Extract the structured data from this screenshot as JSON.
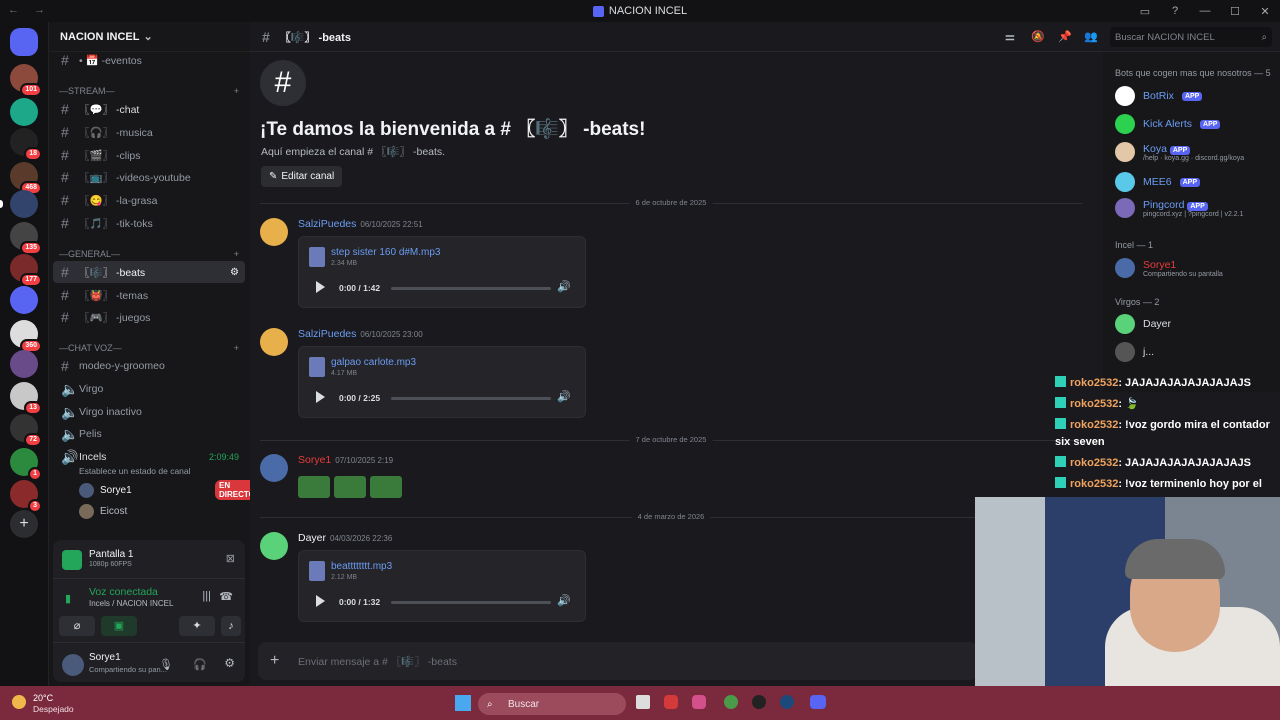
{
  "window": {
    "title": "NACION INCEL",
    "nav": "← →",
    "controls": [
      "▭",
      "?",
      "—",
      "☐",
      "✕"
    ]
  },
  "server": {
    "name": "NACION INCEL"
  },
  "channels": [
    {
      "name": "• 📅 -eventos"
    },
    {
      "category": "—STREAM—"
    },
    {
      "name": "〖💬〗 -chat"
    },
    {
      "name": "〖🎧〗 -musica"
    },
    {
      "name": "〖🎬〗 -clips"
    },
    {
      "name": "〖📺〗 -videos-youtube"
    },
    {
      "name": "〖😋〗 -la-grasa"
    },
    {
      "name": "〖🎵〗 -tik-toks"
    },
    {
      "category": "—GENERAL—"
    },
    {
      "name": "〖🎼〗 -beats"
    },
    {
      "name": "〖👹〗 -temas"
    },
    {
      "name": "〖🎮〗 -juegos"
    },
    {
      "category": "—CHAT VOZ—"
    },
    {
      "name": "modeo-y-groomeo"
    },
    {
      "name": "Virgo"
    },
    {
      "name": "Virgo inactivo"
    },
    {
      "name": "Pelis"
    },
    {
      "name": "Incels",
      "timer": "2:09:49",
      "status": "Establece un estado de canal"
    }
  ],
  "voice_users": [
    {
      "name": "Sorye1",
      "badge": "EN DIRECTO"
    },
    {
      "name": "Eicost"
    }
  ],
  "server_badges": [
    "101",
    "18",
    "468",
    "135",
    "177",
    "360",
    "13",
    "72",
    "1",
    "3"
  ],
  "stream_panel": {
    "title": "Pantalla 1",
    "quality": "1080p 60FPS"
  },
  "voice_panel": {
    "status": "Voz conectada",
    "location": "Incels / NACION INCEL"
  },
  "user_panel": {
    "name": "Sorye1",
    "status": "Compartiendo su pan..."
  },
  "channel_header": {
    "name": "〖🎼〗 -beats"
  },
  "search_placeholder": "Buscar NACION INCEL",
  "welcome": {
    "title": "¡Te damos la bienvenida a # 〖🎼〗 -beats!",
    "subtitle": "Aquí empieza el canal # 〖🎼〗 -beats.",
    "edit_button": "Editar canal"
  },
  "dates": [
    "6 de octubre de 2025",
    "7 de octubre de 2025",
    "4 de marzo de 2026"
  ],
  "messages": [
    {
      "author": "SalziPuedes",
      "time": "06/10/2025 22:51",
      "file": "step sister 160 d#M.mp3",
      "size": "2.34 MB",
      "duration": "0:00 / 1:42"
    },
    {
      "author": "SalziPuedes",
      "time": "06/10/2025 23:00",
      "file": "galpao carlote.mp3",
      "size": "4.17 MB",
      "duration": "0:00 / 2:25"
    },
    {
      "author": "Sorye1",
      "time": "07/10/2025 2:19"
    },
    {
      "author": "Dayer",
      "time": "04/03/2026 22:36",
      "file": "beatttttttt.mp3",
      "size": "2.12 MB",
      "duration": "0:00 / 1:32"
    }
  ],
  "composer_placeholder": "Enviar mensaje a # 〖🎼〗 -beats",
  "members": {
    "bots_header": "Bots que cogen mas que nosotros — 5",
    "bots": [
      {
        "name": "BotRix",
        "tag": "APP"
      },
      {
        "name": "Kick Alerts",
        "tag": "APP"
      },
      {
        "name": "Koya",
        "tag": "APP",
        "sub": "/help · koya.gg · discord.gg/koya"
      },
      {
        "name": "MEE6",
        "tag": "APP"
      },
      {
        "name": "Pingcord",
        "tag": "APP",
        "sub": "pingcord.xyz | ?pingcord | v2.2.1"
      }
    ],
    "incel_header": "Incel — 1",
    "incel": [
      {
        "name": "Sorye1",
        "sub": "Compartiendo su pantalla"
      }
    ],
    "virgos_header": "Virgos — 2",
    "virgos": [
      {
        "name": "Dayer"
      },
      {
        "name": "j..."
      }
    ]
  },
  "overlay": [
    {
      "user": "roko2532",
      "text": ": JAJAJAJAJAJAJAJAJS"
    },
    {
      "user": "roko2532",
      "text": ": 🍃"
    },
    {
      "user": "roko2532",
      "text": ": !voz gordo mira el contador"
    },
    {
      "user": "",
      "text": "six seven"
    },
    {
      "user": "roko2532",
      "text": ": JAJAJAJAJAJAJAJAJS"
    },
    {
      "user": "roko2532",
      "text": ": !voz terminenlo hoy por el"
    }
  ],
  "taskbar": {
    "weather_temp": "20°C",
    "weather_desc": "Despejado",
    "search": "Buscar"
  },
  "colors": {
    "accent": "#5865f2",
    "live": "#da373c",
    "link": "#6b9cf2",
    "sorye": "#e83b3b",
    "salzi": "#6b9cf2",
    "taskbar": "#7b2a3e"
  }
}
